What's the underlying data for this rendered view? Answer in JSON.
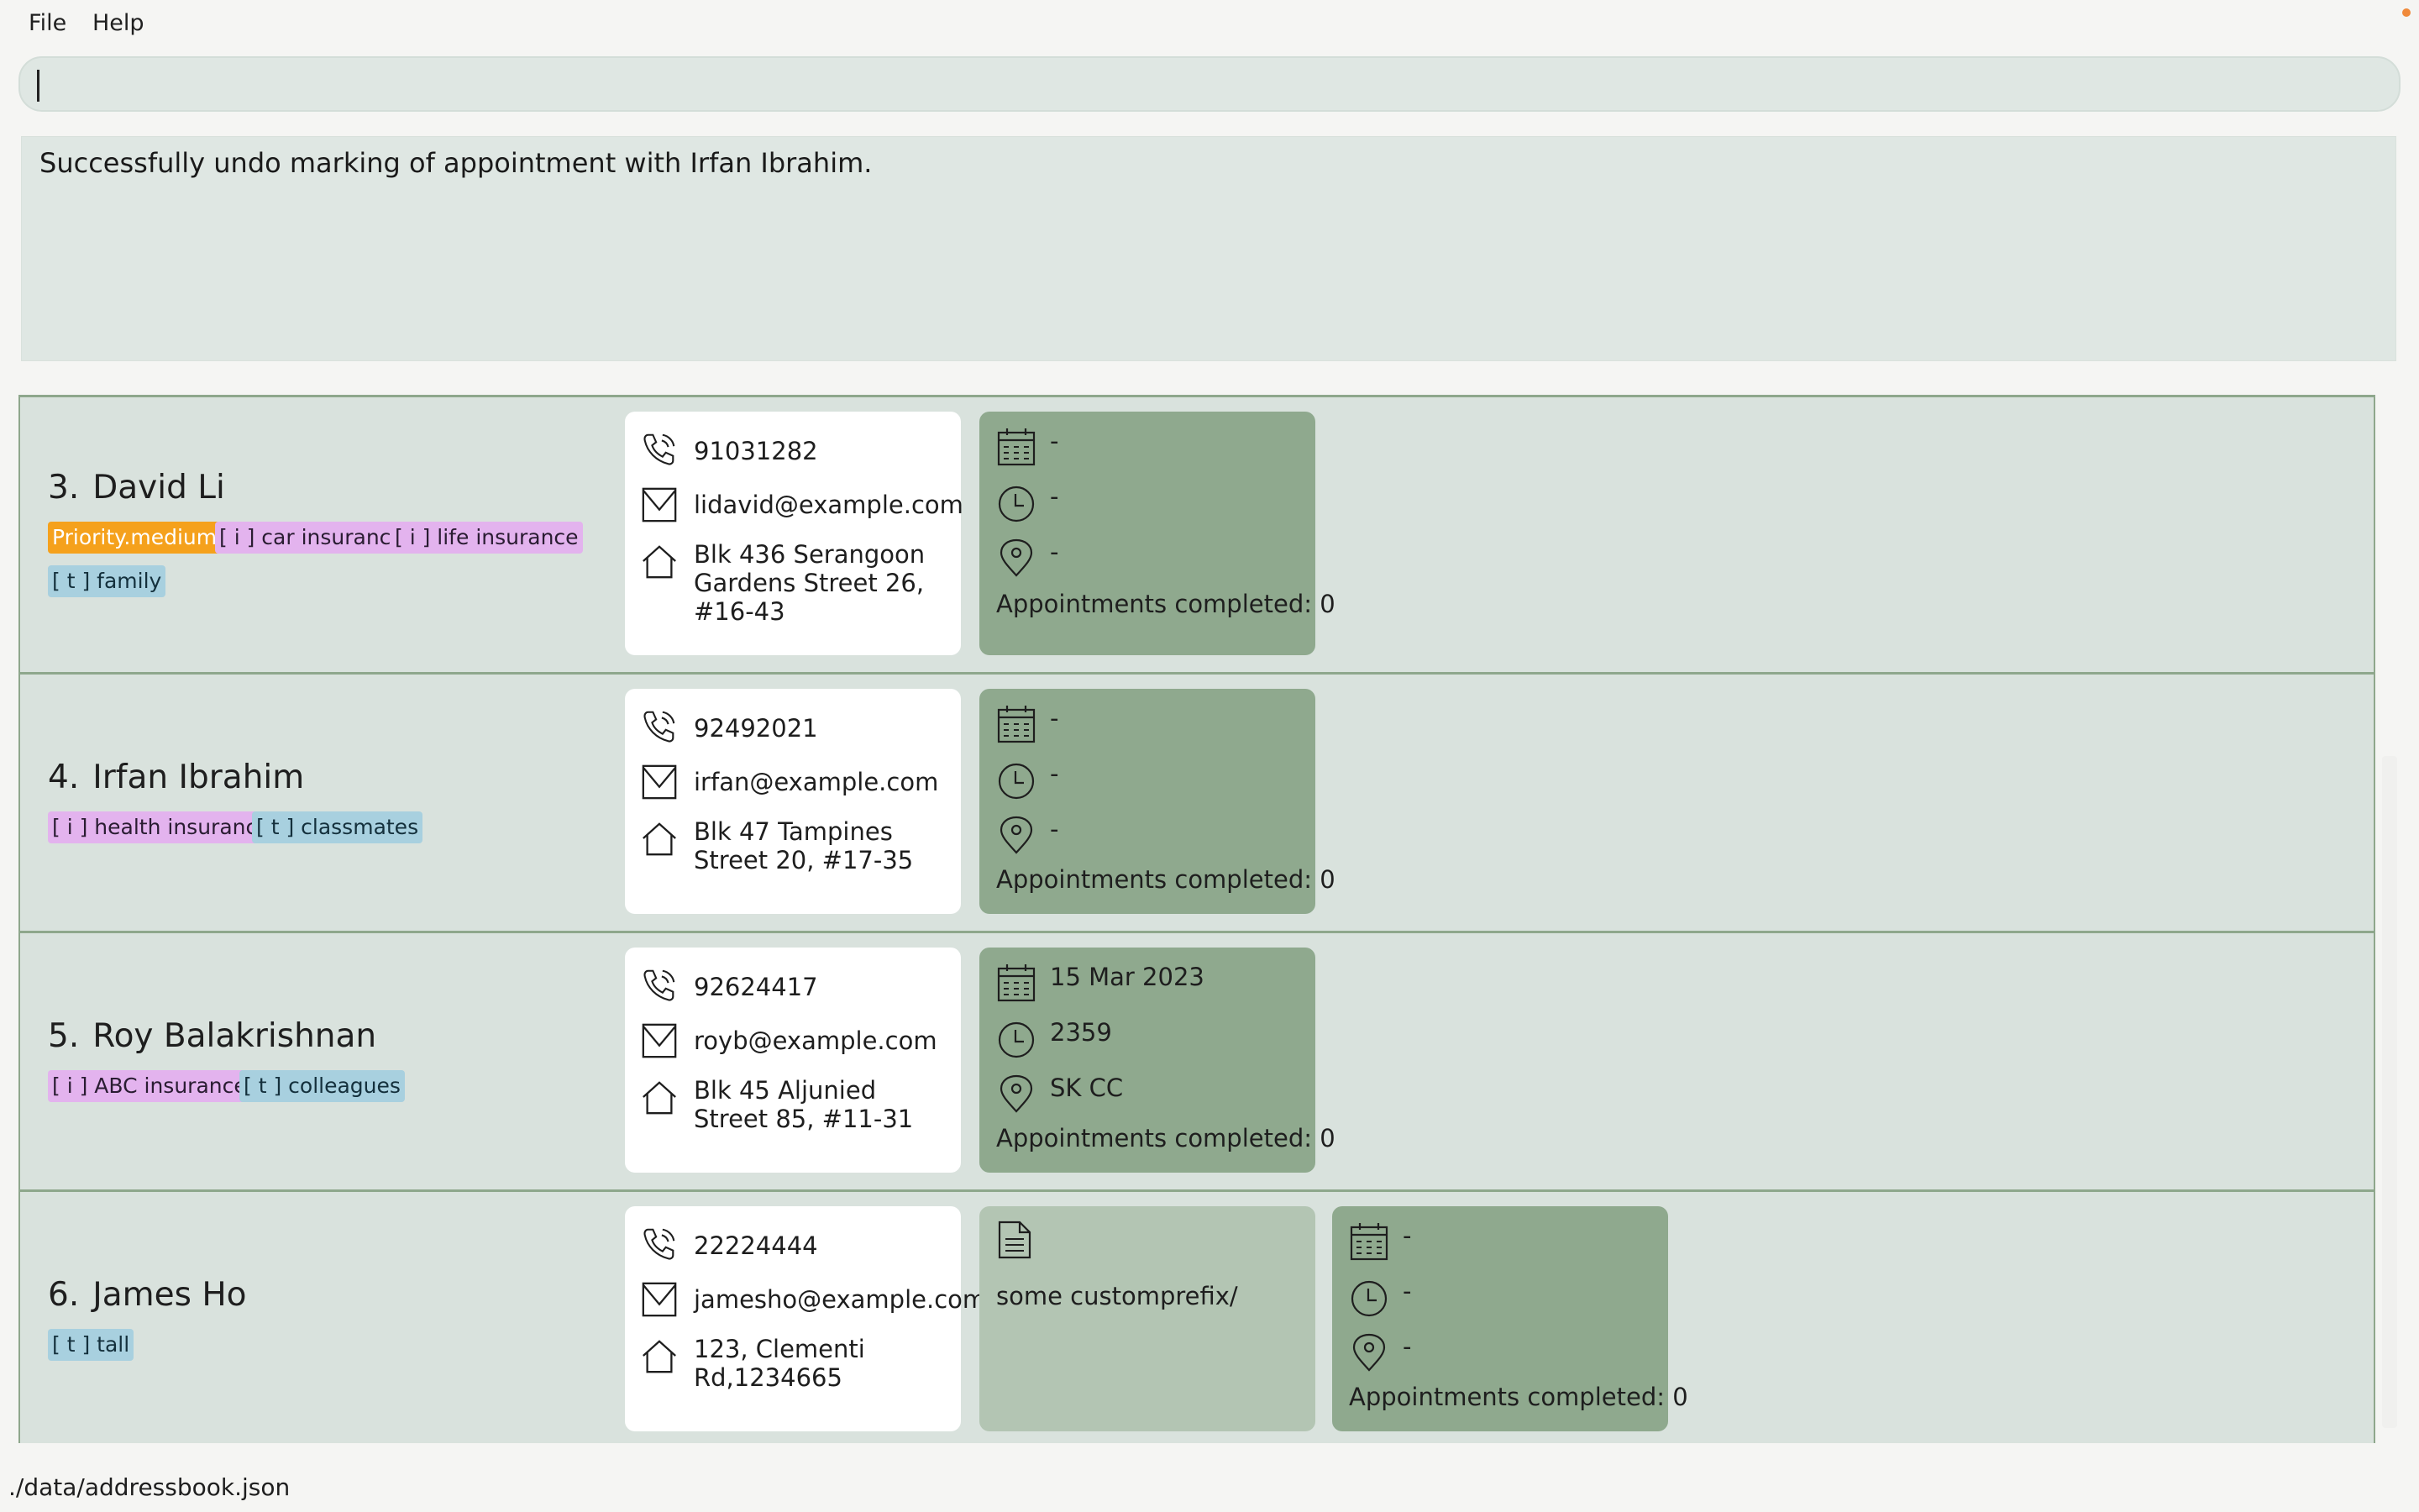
{
  "menu": {
    "file": "File",
    "help": "Help"
  },
  "command": {
    "value": ""
  },
  "result": {
    "message": "Successfully undo marking of appointment with Irfan Ibrahim."
  },
  "persons": [
    {
      "index": "3.",
      "name": "David Li",
      "tags": [
        {
          "text": "Priority.medium",
          "kind": "priority"
        },
        {
          "text": "[ i ] car insurance",
          "kind": "ins"
        },
        {
          "text": "[ i ] life insurance",
          "kind": "ins"
        },
        {
          "text": "[ t ] family",
          "kind": "tag"
        }
      ],
      "phone": "91031282",
      "email": "lidavid@example.com",
      "address": "Blk 436 Serangoon Gardens Street 26, #16-43",
      "appointment": {
        "date": "-",
        "time": "-",
        "venue": "-",
        "completed": "Appointments completed: 0"
      }
    },
    {
      "index": "4.",
      "name": "Irfan Ibrahim",
      "tags": [
        {
          "text": "[ i ] health insurance",
          "kind": "ins"
        },
        {
          "text": "[ t ] classmates",
          "kind": "tag"
        }
      ],
      "phone": "92492021",
      "email": "irfan@example.com",
      "address": "Blk 47 Tampines Street 20, #17-35",
      "appointment": {
        "date": "-",
        "time": "-",
        "venue": "-",
        "completed": "Appointments completed: 0"
      }
    },
    {
      "index": "5.",
      "name": "Roy Balakrishnan",
      "tags": [
        {
          "text": "[ i ] ABC insurance",
          "kind": "ins"
        },
        {
          "text": "[ t ] colleagues",
          "kind": "tag"
        }
      ],
      "phone": "92624417",
      "email": "royb@example.com",
      "address": "Blk 45 Aljunied Street 85, #11-31",
      "appointment": {
        "date": "15 Mar 2023",
        "time": "2359",
        "venue": "SK CC",
        "completed": "Appointments completed: 0"
      }
    },
    {
      "index": "6.",
      "name": "James Ho",
      "tags": [
        {
          "text": "[ t ] tall",
          "kind": "tag"
        }
      ],
      "phone": "22224444",
      "email": "jamesho@example.com",
      "address": "123, Clementi Rd,1234665",
      "note": "some customprefix/",
      "appointment": {
        "date": "-",
        "time": "-",
        "venue": "-",
        "completed": "Appointments completed: 0"
      }
    }
  ],
  "status": {
    "path": "./data/addressbook.json"
  },
  "colors": {
    "card": "#d9e2dd",
    "appointment": "#8fa98e",
    "note": "#b3c5b3",
    "priority": "#f5a11c",
    "insurance": "#e3b3ee",
    "tag": "#a8d0df"
  },
  "icons": [
    "phone-icon",
    "email-icon",
    "home-icon",
    "calendar-icon",
    "clock-icon",
    "location-icon",
    "note-icon"
  ]
}
